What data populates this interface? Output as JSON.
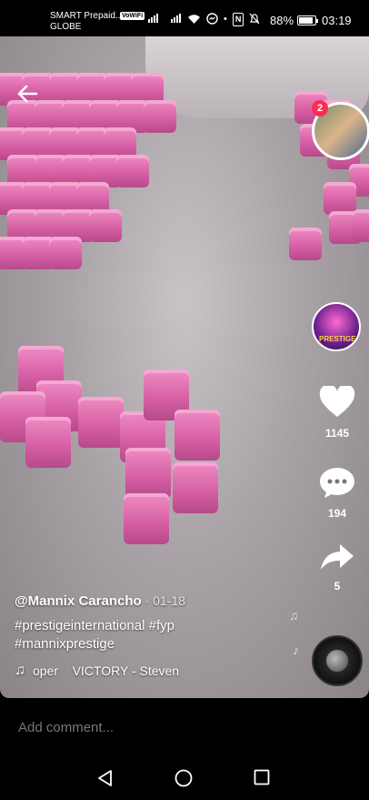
{
  "status_bar": {
    "carrier_line1": "SMART Prepaid...",
    "carrier_line2": "GLOBE",
    "vowifi": "VoWiFi",
    "nfc": "N",
    "battery": "88%",
    "time": "03:19"
  },
  "live": {
    "badge_count": "2"
  },
  "actions": {
    "like_count": "1145",
    "comment_count": "194",
    "share_count": "5"
  },
  "profile": {
    "avatar_text": "PRESTIGE"
  },
  "caption": {
    "username": "@Mannix Carancho",
    "date": " · 01-18",
    "hashtags_line1": "#prestigeinternational #fyp",
    "hashtags_line2": "#mannixprestige",
    "music": "oper    VICTORY - Steven"
  },
  "comment": {
    "placeholder": "Add comment..."
  },
  "icons": {
    "back": "back-arrow-icon",
    "like": "heart-icon",
    "comment": "comment-bubble-icon",
    "share": "share-arrow-icon",
    "music": "music-note-icon",
    "nav_back": "triangle-back-icon",
    "nav_home": "circle-home-icon",
    "nav_recent": "square-recent-icon"
  },
  "colors": {
    "accent": "#fe2c55",
    "product_pink": "#e06aae"
  }
}
